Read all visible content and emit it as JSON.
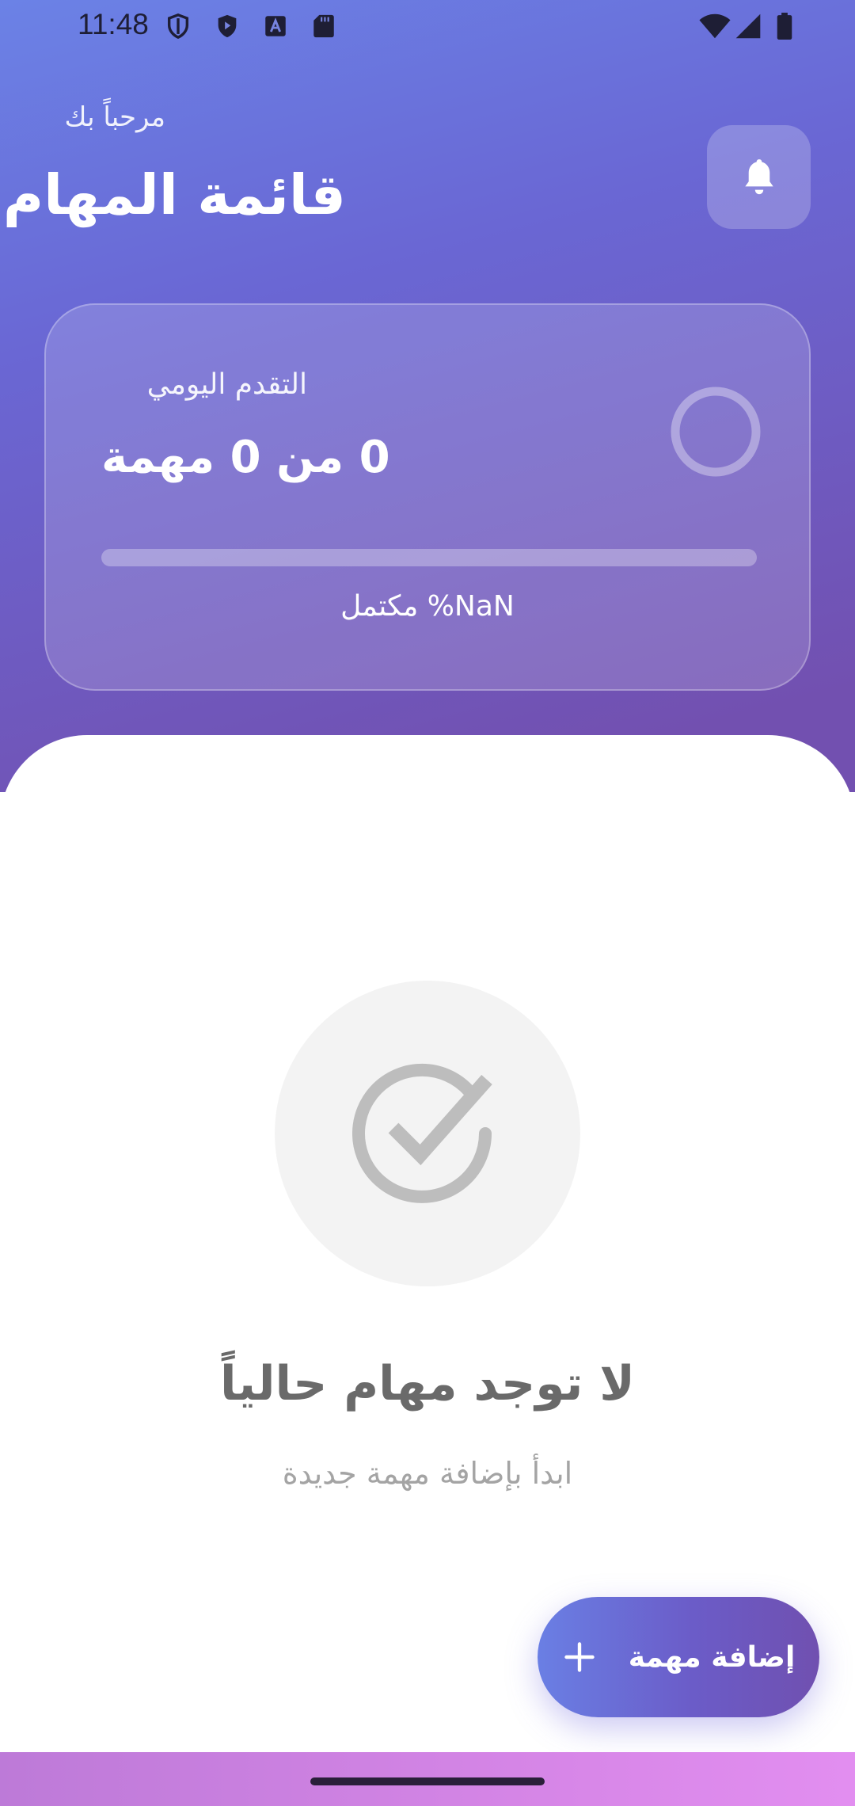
{
  "status_bar": {
    "time": "11:48",
    "left_icons": [
      "shield-outline-icon",
      "shield-play-icon",
      "font-a-icon",
      "sd-card-icon"
    ],
    "right_icons": [
      "wifi-icon",
      "signal-icon",
      "battery-icon"
    ]
  },
  "header": {
    "greeting": "مرحباً بك",
    "title": "قائمة المهام",
    "bell_icon": "bell-icon"
  },
  "progress": {
    "label": "التقدم اليومي",
    "count_text": "0 من 0 مهمة",
    "percent_text": "NaN% مكتمل",
    "fraction": 0
  },
  "empty_state": {
    "icon": "check-circle-icon",
    "title": "لا توجد مهام حالياً",
    "subtitle": "ابدأ بإضافة مهمة جديدة"
  },
  "fab": {
    "label": "إضافة مهمة",
    "icon": "plus-icon"
  },
  "colors": {
    "gradient_start": "#6b82e6",
    "gradient_end": "#7250b0",
    "sheet": "#ffffff",
    "empty_icon": "#bdbdbd"
  }
}
